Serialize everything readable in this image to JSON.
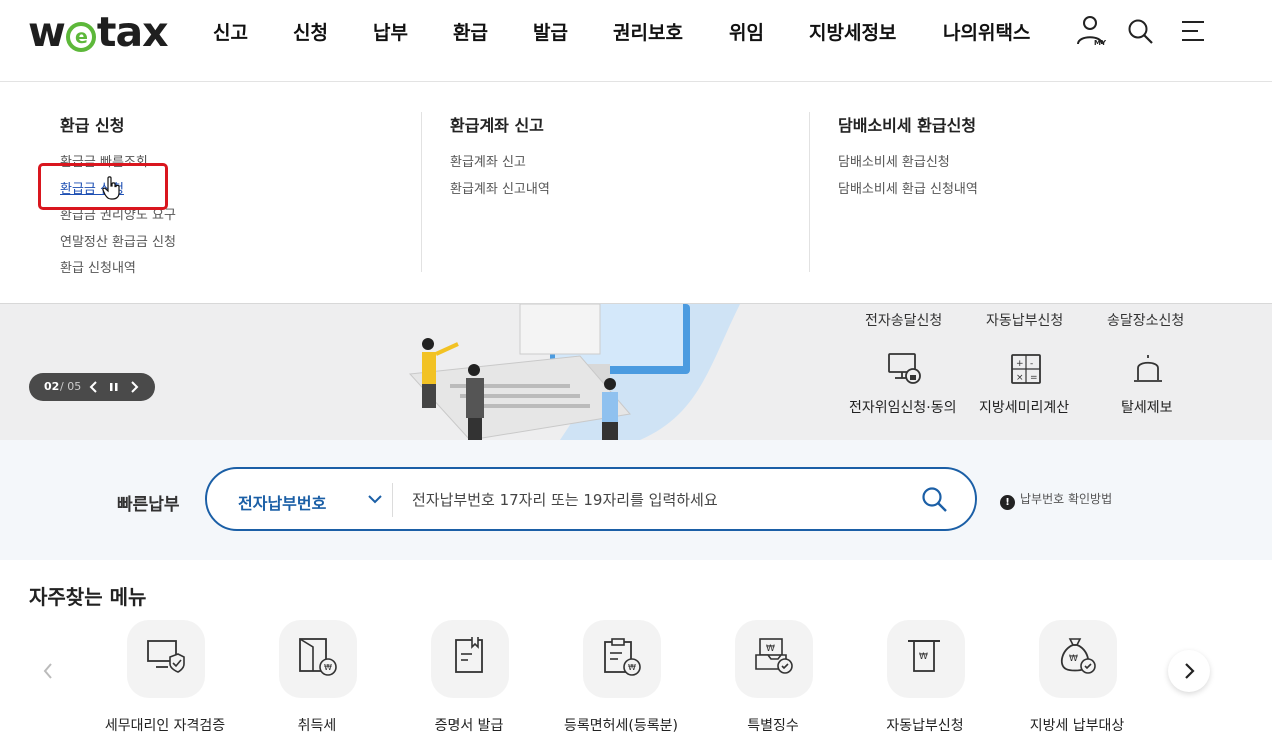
{
  "header": {
    "logo": {
      "pre": "w",
      "e": "e",
      "post": "tax"
    },
    "nav": [
      "신고",
      "신청",
      "납부",
      "환급",
      "발급",
      "권리보호",
      "위임",
      "지방세정보",
      "나의위택스"
    ],
    "icons": [
      "my-user-icon",
      "search-icon",
      "menu-icon"
    ],
    "my_label": "MY"
  },
  "dropdown": {
    "columns": [
      {
        "title": "환급 신청",
        "links": [
          "환급금 빠른조회",
          "환급금 신청",
          "환급금 권리양도 요구",
          "연말정산 환급금 신청",
          "환급 신청내역"
        ],
        "active_index": 1
      },
      {
        "title": "환급계좌 신고",
        "links": [
          "환급계좌 신고",
          "환급계좌 신고내역"
        ]
      },
      {
        "title": "담배소비세 환급신청",
        "links": [
          "담배소비세 환급신청",
          "담배소비세 환급 신청내역"
        ]
      }
    ],
    "highlight_color": "#d9161e"
  },
  "hero": {
    "slide_current": "02",
    "slide_total": "/ 05",
    "quick_top": [
      "전자송달신청",
      "자동납부신청",
      "송달장소신청"
    ],
    "quick_icons": [
      {
        "label": "전자위임신청·동의",
        "icon": "monitor-lock-icon"
      },
      {
        "label": "지방세미리계산",
        "icon": "calculator-icon"
      },
      {
        "label": "탈세제보",
        "icon": "siren-icon"
      }
    ]
  },
  "quickpay": {
    "title": "빠른납부",
    "select_value": "전자납부번호",
    "placeholder": "전자납부번호 17자리 또는 19자리를 입력하세요",
    "help": "납부번호 확인방법",
    "accent": "#1b5fa6"
  },
  "frequent": {
    "title": "자주찾는 메뉴",
    "items": [
      {
        "label": "세무대리인 자격검증",
        "icon": "monitor-shield-icon"
      },
      {
        "label": "취득세",
        "icon": "door-won-icon"
      },
      {
        "label": "증명서 발급",
        "icon": "document-bookmark-icon"
      },
      {
        "label": "등록면허세(등록분)",
        "icon": "clipboard-won-icon"
      },
      {
        "label": "특별징수",
        "icon": "envelope-check-icon"
      },
      {
        "label": "자동납부신청",
        "icon": "atm-won-icon"
      },
      {
        "label": "지방세 납부대상",
        "icon": "money-bag-check-icon"
      }
    ]
  }
}
